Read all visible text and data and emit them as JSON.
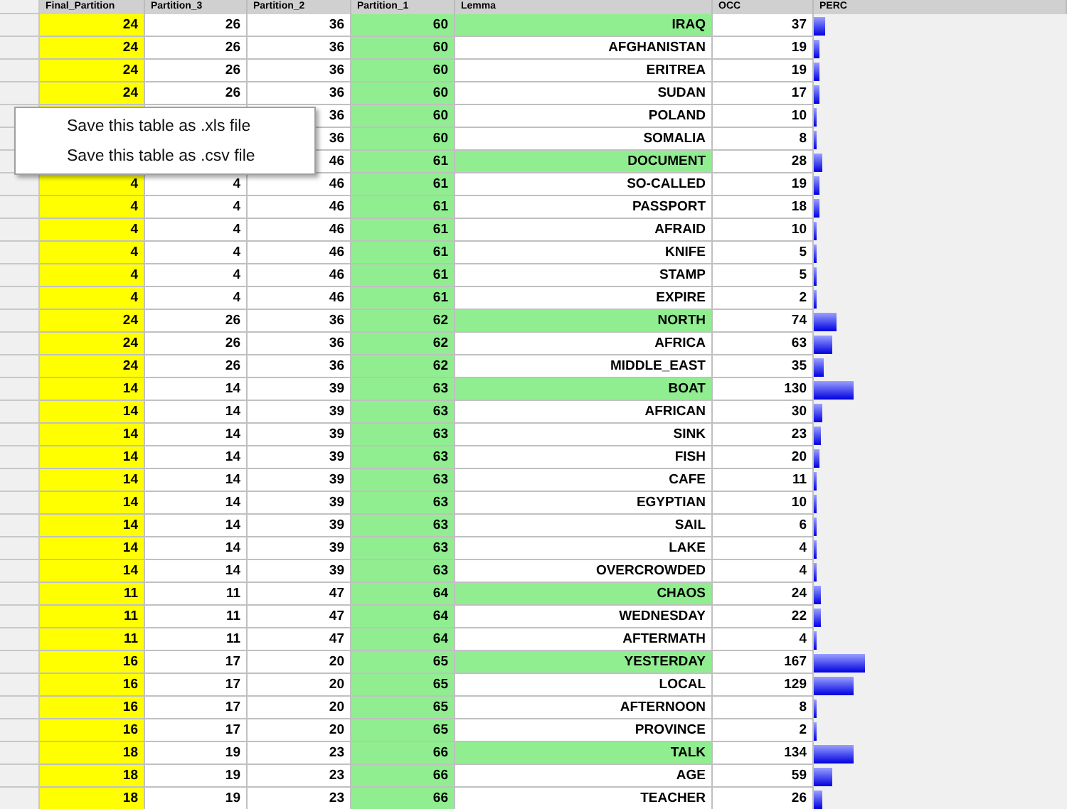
{
  "columns": [
    "Final_Partition",
    "Partition_3",
    "Partition_2",
    "Partition_1",
    "Lemma",
    "OCC",
    "PERC"
  ],
  "rows": [
    {
      "final": "24",
      "p3": "26",
      "p2": "36",
      "p1": "60",
      "lemma": "IRAQ",
      "highlighted": true,
      "occ": "37",
      "level": 0.044
    },
    {
      "final": "24",
      "p3": "26",
      "p2": "36",
      "p1": "60",
      "lemma": "AFGHANISTAN",
      "highlighted": false,
      "occ": "19",
      "level": 0.023
    },
    {
      "final": "24",
      "p3": "26",
      "p2": "36",
      "p1": "60",
      "lemma": "ERITREA",
      "highlighted": false,
      "occ": "19",
      "level": 0.023
    },
    {
      "final": "24",
      "p3": "26",
      "p2": "36",
      "p1": "60",
      "lemma": "SUDAN",
      "highlighted": false,
      "occ": "17",
      "level": 0.02
    },
    {
      "p2": "36",
      "p1": "60",
      "lemma": "POLAND",
      "highlighted": false,
      "occ": "10",
      "level": 0.012
    },
    {
      "p2": "36",
      "p1": "60",
      "lemma": "SOMALIA",
      "highlighted": false,
      "occ": "8",
      "level": 0.01
    },
    {
      "p2": "46",
      "p1": "61",
      "lemma": "DOCUMENT",
      "highlighted": true,
      "occ": "28",
      "level": 0.034
    },
    {
      "final": "4",
      "p3": "4",
      "p2": "46",
      "p1": "61",
      "lemma": "SO-CALLED",
      "highlighted": false,
      "occ": "19",
      "level": 0.023
    },
    {
      "final": "4",
      "p3": "4",
      "p2": "46",
      "p1": "61",
      "lemma": "PASSPORT",
      "highlighted": false,
      "occ": "18",
      "level": 0.022
    },
    {
      "final": "4",
      "p3": "4",
      "p2": "46",
      "p1": "61",
      "lemma": "AFRAID",
      "highlighted": false,
      "occ": "10",
      "level": 0.012
    },
    {
      "final": "4",
      "p3": "4",
      "p2": "46",
      "p1": "61",
      "lemma": "KNIFE",
      "highlighted": false,
      "occ": "5",
      "level": 0.006
    },
    {
      "final": "4",
      "p3": "4",
      "p2": "46",
      "p1": "61",
      "lemma": "STAMP",
      "highlighted": false,
      "occ": "5",
      "level": 0.006
    },
    {
      "final": "4",
      "p3": "4",
      "p2": "46",
      "p1": "61",
      "lemma": "EXPIRE",
      "highlighted": false,
      "occ": "2",
      "level": 0.0024
    },
    {
      "final": "24",
      "p3": "26",
      "p2": "36",
      "p1": "62",
      "lemma": "NORTH",
      "highlighted": true,
      "occ": "74",
      "level": 0.089
    },
    {
      "final": "24",
      "p3": "26",
      "p2": "36",
      "p1": "62",
      "lemma": "AFRICA",
      "highlighted": false,
      "occ": "63",
      "level": 0.075
    },
    {
      "final": "24",
      "p3": "26",
      "p2": "36",
      "p1": "62",
      "lemma": "MIDDLE_EAST",
      "highlighted": false,
      "occ": "35",
      "level": 0.042
    },
    {
      "final": "14",
      "p3": "14",
      "p2": "39",
      "p1": "63",
      "lemma": "BOAT",
      "highlighted": true,
      "occ": "130",
      "level": 0.156
    },
    {
      "final": "14",
      "p3": "14",
      "p2": "39",
      "p1": "63",
      "lemma": "AFRICAN",
      "highlighted": false,
      "occ": "30",
      "level": 0.036
    },
    {
      "final": "14",
      "p3": "14",
      "p2": "39",
      "p1": "63",
      "lemma": "SINK",
      "highlighted": false,
      "occ": "23",
      "level": 0.028
    },
    {
      "final": "14",
      "p3": "14",
      "p2": "39",
      "p1": "63",
      "lemma": "FISH",
      "highlighted": false,
      "occ": "20",
      "level": 0.024
    },
    {
      "final": "14",
      "p3": "14",
      "p2": "39",
      "p1": "63",
      "lemma": "CAFE",
      "highlighted": false,
      "occ": "11",
      "level": 0.013
    },
    {
      "final": "14",
      "p3": "14",
      "p2": "39",
      "p1": "63",
      "lemma": "EGYPTIAN",
      "highlighted": false,
      "occ": "10",
      "level": 0.012
    },
    {
      "final": "14",
      "p3": "14",
      "p2": "39",
      "p1": "63",
      "lemma": "SAIL",
      "highlighted": false,
      "occ": "6",
      "level": 0.007
    },
    {
      "final": "14",
      "p3": "14",
      "p2": "39",
      "p1": "63",
      "lemma": "LAKE",
      "highlighted": false,
      "occ": "4",
      "level": 0.005
    },
    {
      "final": "14",
      "p3": "14",
      "p2": "39",
      "p1": "63",
      "lemma": "OVERCROWDED",
      "highlighted": false,
      "occ": "4",
      "level": 0.005
    },
    {
      "final": "11",
      "p3": "11",
      "p2": "47",
      "p1": "64",
      "lemma": "CHAOS",
      "highlighted": true,
      "occ": "24",
      "level": 0.029
    },
    {
      "final": "11",
      "p3": "11",
      "p2": "47",
      "p1": "64",
      "lemma": "WEDNESDAY",
      "highlighted": false,
      "occ": "22",
      "level": 0.026
    },
    {
      "final": "11",
      "p3": "11",
      "p2": "47",
      "p1": "64",
      "lemma": "AFTERMATH",
      "highlighted": false,
      "occ": "4",
      "level": 0.005
    },
    {
      "final": "16",
      "p3": "17",
      "p2": "20",
      "p1": "65",
      "lemma": "YESTERDAY",
      "highlighted": true,
      "occ": "167",
      "level": 0.2
    },
    {
      "final": "16",
      "p3": "17",
      "p2": "20",
      "p1": "65",
      "lemma": "LOCAL",
      "highlighted": false,
      "occ": "129",
      "level": 0.155
    },
    {
      "final": "16",
      "p3": "17",
      "p2": "20",
      "p1": "65",
      "lemma": "AFTERNOON",
      "highlighted": false,
      "occ": "8",
      "level": 0.01
    },
    {
      "final": "16",
      "p3": "17",
      "p2": "20",
      "p1": "65",
      "lemma": "PROVINCE",
      "highlighted": false,
      "occ": "2",
      "level": 0.0024
    },
    {
      "final": "18",
      "p3": "19",
      "p2": "23",
      "p1": "66",
      "lemma": "TALK",
      "highlighted": true,
      "occ": "134",
      "level": 0.16
    },
    {
      "final": "18",
      "p3": "19",
      "p2": "23",
      "p1": "66",
      "lemma": "AGE",
      "highlighted": false,
      "occ": "59",
      "level": 0.071
    },
    {
      "final": "18",
      "p3": "19",
      "p2": "23",
      "p1": "66",
      "lemma": "TEACHER",
      "highlighted": false,
      "occ": "26",
      "level": 0.031
    }
  ],
  "context_menu": [
    "Save this table as .xls file",
    "Save this table as .csv file"
  ]
}
